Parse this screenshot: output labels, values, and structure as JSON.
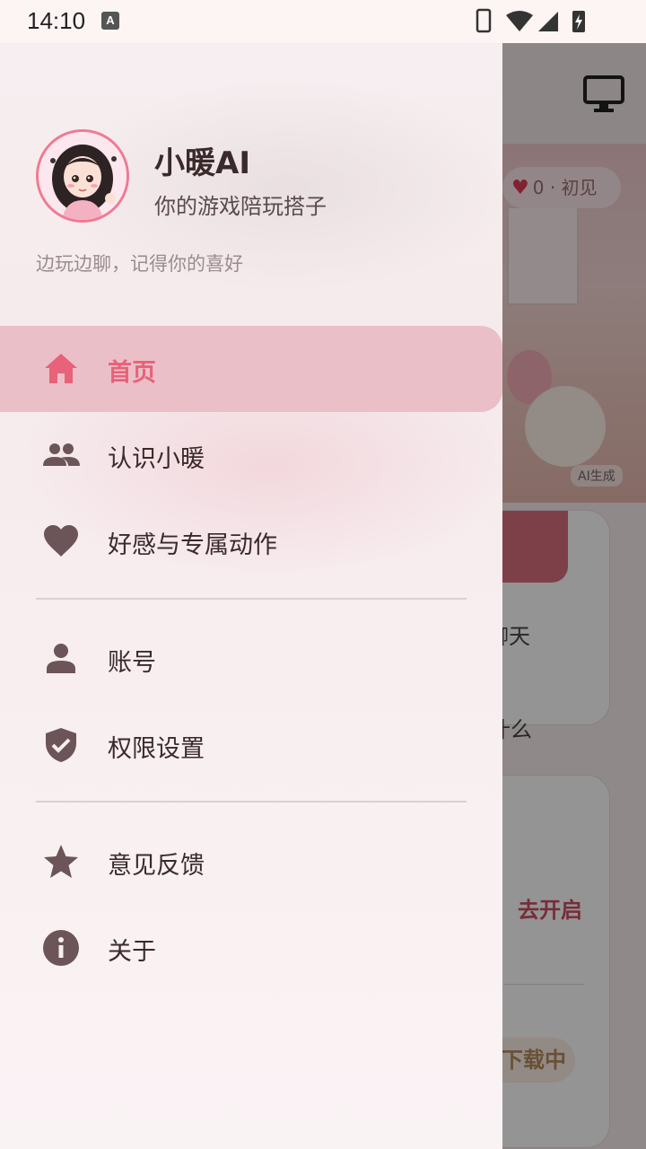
{
  "status_bar": {
    "time": "14:10",
    "notification_badge": "A"
  },
  "background": {
    "affinity_badge": "0 · 初见",
    "ai_tag": "AI生成",
    "card1_text": "聊天",
    "question_text": "什么",
    "open_button": "去开启",
    "download_status": "下载中"
  },
  "drawer": {
    "app_title": "小暖AI",
    "app_subtitle": "你的游戏陪玩搭子",
    "tagline": "边玩边聊，记得你的喜好",
    "items": [
      {
        "label": "首页",
        "icon": "home-icon"
      },
      {
        "label": "认识小暖",
        "icon": "people-icon"
      },
      {
        "label": "好感与专属动作",
        "icon": "heart-icon"
      },
      {
        "label": "账号",
        "icon": "person-icon"
      },
      {
        "label": "权限设置",
        "icon": "shield-check-icon"
      },
      {
        "label": "意见反馈",
        "icon": "star-icon"
      },
      {
        "label": "关于",
        "icon": "info-icon"
      }
    ]
  },
  "colors": {
    "accent": "#e8627a",
    "active_bg": "#ebbfc8",
    "icon": "#6b5559"
  }
}
